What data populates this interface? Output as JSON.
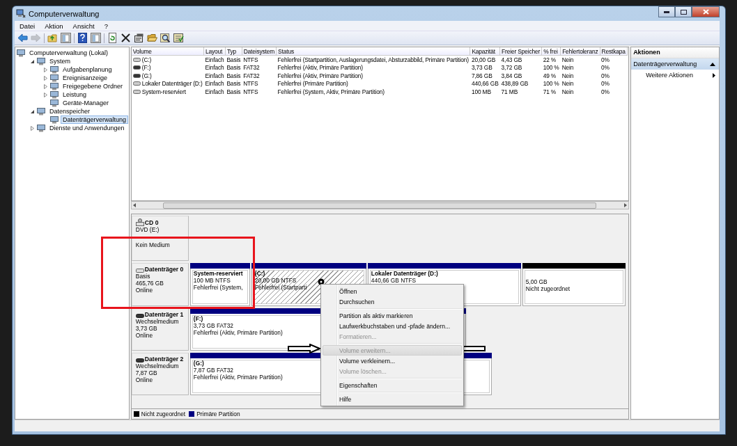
{
  "window": {
    "title": "Computerverwaltung"
  },
  "menu_bar": [
    {
      "label": "Datei"
    },
    {
      "label": "Aktion"
    },
    {
      "label": "Ansicht"
    },
    {
      "label": "?"
    }
  ],
  "toolbar": [
    {
      "kind": "back",
      "disabled": false
    },
    {
      "kind": "forward",
      "disabled": true
    },
    {
      "kind": "sep"
    },
    {
      "kind": "up",
      "disabled": false
    },
    {
      "kind": "pane",
      "disabled": false
    },
    {
      "kind": "sep"
    },
    {
      "kind": "help",
      "disabled": false
    },
    {
      "kind": "pane",
      "disabled": false
    },
    {
      "kind": "sep"
    },
    {
      "kind": "refresh",
      "disabled": false
    },
    {
      "kind": "delete",
      "disabled": false
    },
    {
      "kind": "properties",
      "disabled": false
    },
    {
      "kind": "open",
      "disabled": false
    },
    {
      "kind": "search",
      "disabled": false
    },
    {
      "kind": "checklist",
      "disabled": false
    }
  ],
  "tree": [
    {
      "label": "Computerverwaltung (Lokal)",
      "selected": false,
      "children": [
        {
          "label": "System",
          "expanded": true,
          "selected": false,
          "children": [
            {
              "label": "Aufgabenplanung",
              "expanded": false,
              "selected": false
            },
            {
              "label": "Ereignisanzeige",
              "expanded": false,
              "selected": false
            },
            {
              "label": "Freigegebene Ordner",
              "expanded": false,
              "selected": false
            },
            {
              "label": "Leistung",
              "expanded": false,
              "selected": false
            },
            {
              "label": "Geräte-Manager",
              "selected": false
            }
          ]
        },
        {
          "label": "Datenspeicher",
          "expanded": true,
          "selected": false,
          "children": [
            {
              "label": "Datenträgerverwaltung",
              "selected": true
            }
          ]
        },
        {
          "label": "Dienste und Anwendungen",
          "expanded": false,
          "selected": false
        }
      ]
    }
  ],
  "volume_table": {
    "columns": [
      "Volume",
      "Layout",
      "Typ",
      "Dateisystem",
      "Status",
      "Kapazität",
      "Freier Speicher",
      "% frei",
      "Fehlertoleranz",
      "Restkapa"
    ],
    "rows": [
      {
        "kind": "fixed",
        "cells": [
          "(C:)",
          "Einfach",
          "Basis",
          "NTFS",
          "Fehlerfrei (Startpartition, Auslagerungsdatei, Absturzabbild, Primäre Partition)",
          "20,00 GB",
          "4,43 GB",
          "22 %",
          "Nein",
          "0%"
        ]
      },
      {
        "kind": "removable",
        "cells": [
          "(F:)",
          "Einfach",
          "Basis",
          "FAT32",
          "Fehlerfrei (Aktiv, Primäre Partition)",
          "3,73 GB",
          "3,72 GB",
          "100 %",
          "Nein",
          "0%"
        ]
      },
      {
        "kind": "removable",
        "cells": [
          "(G:)",
          "Einfach",
          "Basis",
          "FAT32",
          "Fehlerfrei (Aktiv, Primäre Partition)",
          "7,86 GB",
          "3,84 GB",
          "49 %",
          "Nein",
          "0%"
        ]
      },
      {
        "kind": "fixed",
        "cells": [
          "Lokaler Datenträger (D:)",
          "Einfach",
          "Basis",
          "NTFS",
          "Fehlerfrei (Primäre Partition)",
          "440,66 GB",
          "438,89 GB",
          "100 %",
          "Nein",
          "0%"
        ]
      },
      {
        "kind": "fixed",
        "cells": [
          "System-reserviert",
          "Einfach",
          "Basis",
          "NTFS",
          "Fehlerfrei (System, Aktiv, Primäre Partition)",
          "100 MB",
          "71 MB",
          "71 %",
          "Nein",
          "0%"
        ]
      }
    ]
  },
  "disks": [
    {
      "kind": "cd",
      "name": "CD 0",
      "type": "DVD (E:)",
      "status": "Kein Medium"
    },
    {
      "kind": "fixed",
      "name": "Datenträger 0",
      "type": "Basis",
      "size": "465,76 GB",
      "status": "Online",
      "partitions": [
        {
          "kind": "primary",
          "selected": false,
          "name": "System-reserviert",
          "size": "100 MB NTFS",
          "status": "Fehlerfrei (System,"
        },
        {
          "kind": "primary",
          "selected": true,
          "name": "(C:)",
          "size": "20,00 GB NTFS",
          "status": "Fehlerfrei (Startparti"
        },
        {
          "kind": "primary",
          "selected": false,
          "name": "Lokaler Datenträger  (D:)",
          "size": "440,66 GB NTFS"
        },
        {
          "kind": "unallocated",
          "selected": false,
          "size": "5,00 GB",
          "status": "Nicht zugeordnet"
        }
      ]
    },
    {
      "kind": "removable",
      "name": "Datenträger 1",
      "type": "Wechselmedium",
      "size": "3,73 GB",
      "status": "Online",
      "partitions": [
        {
          "kind": "primary",
          "selected": false,
          "name": "(F:)",
          "size": "3,73 GB FAT32",
          "status": "Fehlerfrei (Aktiv, Primäre Partition)"
        }
      ]
    },
    {
      "kind": "removable",
      "name": "Datenträger 2",
      "type": "Wechselmedium",
      "size": "7,87 GB",
      "status": "Online",
      "partitions": [
        {
          "kind": "primary",
          "selected": false,
          "name": "(G:)",
          "size": "7,87 GB FAT32",
          "status": "Fehlerfrei (Aktiv, Primäre Partition)"
        }
      ]
    }
  ],
  "legend": [
    {
      "label": "Nicht zugeordnet",
      "color": "#000000"
    },
    {
      "label": "Primäre Partition",
      "color": "#000080"
    }
  ],
  "actions": {
    "title": "Aktionen",
    "sections": [
      {
        "label": "Datenträgerverwaltung",
        "expanded": true,
        "items": [
          {
            "label": "Weitere Aktionen"
          }
        ]
      }
    ]
  },
  "context_menu": [
    {
      "kind": "item",
      "label": "Öffnen",
      "disabled": false,
      "selected": false
    },
    {
      "kind": "item",
      "label": "Durchsuchen",
      "disabled": false,
      "selected": false
    },
    {
      "kind": "separator"
    },
    {
      "kind": "item",
      "label": "Partition als aktiv markieren",
      "disabled": false,
      "selected": false
    },
    {
      "kind": "item",
      "label": "Laufwerkbuchstaben und -pfade ändern...",
      "disabled": false,
      "selected": false
    },
    {
      "kind": "item",
      "label": "Formatieren...",
      "disabled": true,
      "selected": false
    },
    {
      "kind": "separator"
    },
    {
      "kind": "item",
      "label": "Volume erweitern...",
      "disabled": true,
      "selected": true
    },
    {
      "kind": "item",
      "label": "Volume verkleinern...",
      "disabled": false,
      "selected": false
    },
    {
      "kind": "item",
      "label": "Volume löschen...",
      "disabled": true,
      "selected": false
    },
    {
      "kind": "separator"
    },
    {
      "kind": "item",
      "label": "Eigenschaften",
      "disabled": false,
      "selected": false
    },
    {
      "kind": "separator"
    },
    {
      "kind": "item",
      "label": "Hilfe",
      "disabled": false,
      "selected": false
    }
  ]
}
